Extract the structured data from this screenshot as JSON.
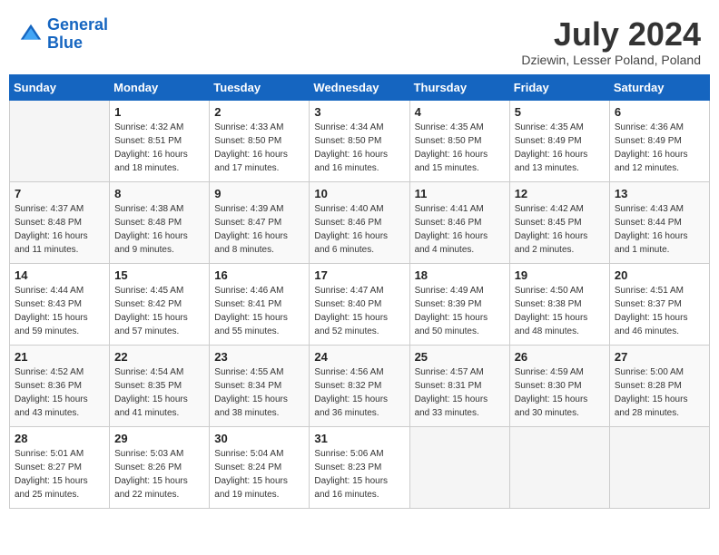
{
  "logo": {
    "line1": "General",
    "line2": "Blue"
  },
  "title": "July 2024",
  "location": "Dziewin, Lesser Poland, Poland",
  "weekdays": [
    "Sunday",
    "Monday",
    "Tuesday",
    "Wednesday",
    "Thursday",
    "Friday",
    "Saturday"
  ],
  "weeks": [
    [
      {
        "day": "",
        "sunrise": "",
        "sunset": "",
        "daylight": ""
      },
      {
        "day": "1",
        "sunrise": "Sunrise: 4:32 AM",
        "sunset": "Sunset: 8:51 PM",
        "daylight": "Daylight: 16 hours and 18 minutes."
      },
      {
        "day": "2",
        "sunrise": "Sunrise: 4:33 AM",
        "sunset": "Sunset: 8:50 PM",
        "daylight": "Daylight: 16 hours and 17 minutes."
      },
      {
        "day": "3",
        "sunrise": "Sunrise: 4:34 AM",
        "sunset": "Sunset: 8:50 PM",
        "daylight": "Daylight: 16 hours and 16 minutes."
      },
      {
        "day": "4",
        "sunrise": "Sunrise: 4:35 AM",
        "sunset": "Sunset: 8:50 PM",
        "daylight": "Daylight: 16 hours and 15 minutes."
      },
      {
        "day": "5",
        "sunrise": "Sunrise: 4:35 AM",
        "sunset": "Sunset: 8:49 PM",
        "daylight": "Daylight: 16 hours and 13 minutes."
      },
      {
        "day": "6",
        "sunrise": "Sunrise: 4:36 AM",
        "sunset": "Sunset: 8:49 PM",
        "daylight": "Daylight: 16 hours and 12 minutes."
      }
    ],
    [
      {
        "day": "7",
        "sunrise": "Sunrise: 4:37 AM",
        "sunset": "Sunset: 8:48 PM",
        "daylight": "Daylight: 16 hours and 11 minutes."
      },
      {
        "day": "8",
        "sunrise": "Sunrise: 4:38 AM",
        "sunset": "Sunset: 8:48 PM",
        "daylight": "Daylight: 16 hours and 9 minutes."
      },
      {
        "day": "9",
        "sunrise": "Sunrise: 4:39 AM",
        "sunset": "Sunset: 8:47 PM",
        "daylight": "Daylight: 16 hours and 8 minutes."
      },
      {
        "day": "10",
        "sunrise": "Sunrise: 4:40 AM",
        "sunset": "Sunset: 8:46 PM",
        "daylight": "Daylight: 16 hours and 6 minutes."
      },
      {
        "day": "11",
        "sunrise": "Sunrise: 4:41 AM",
        "sunset": "Sunset: 8:46 PM",
        "daylight": "Daylight: 16 hours and 4 minutes."
      },
      {
        "day": "12",
        "sunrise": "Sunrise: 4:42 AM",
        "sunset": "Sunset: 8:45 PM",
        "daylight": "Daylight: 16 hours and 2 minutes."
      },
      {
        "day": "13",
        "sunrise": "Sunrise: 4:43 AM",
        "sunset": "Sunset: 8:44 PM",
        "daylight": "Daylight: 16 hours and 1 minute."
      }
    ],
    [
      {
        "day": "14",
        "sunrise": "Sunrise: 4:44 AM",
        "sunset": "Sunset: 8:43 PM",
        "daylight": "Daylight: 15 hours and 59 minutes."
      },
      {
        "day": "15",
        "sunrise": "Sunrise: 4:45 AM",
        "sunset": "Sunset: 8:42 PM",
        "daylight": "Daylight: 15 hours and 57 minutes."
      },
      {
        "day": "16",
        "sunrise": "Sunrise: 4:46 AM",
        "sunset": "Sunset: 8:41 PM",
        "daylight": "Daylight: 15 hours and 55 minutes."
      },
      {
        "day": "17",
        "sunrise": "Sunrise: 4:47 AM",
        "sunset": "Sunset: 8:40 PM",
        "daylight": "Daylight: 15 hours and 52 minutes."
      },
      {
        "day": "18",
        "sunrise": "Sunrise: 4:49 AM",
        "sunset": "Sunset: 8:39 PM",
        "daylight": "Daylight: 15 hours and 50 minutes."
      },
      {
        "day": "19",
        "sunrise": "Sunrise: 4:50 AM",
        "sunset": "Sunset: 8:38 PM",
        "daylight": "Daylight: 15 hours and 48 minutes."
      },
      {
        "day": "20",
        "sunrise": "Sunrise: 4:51 AM",
        "sunset": "Sunset: 8:37 PM",
        "daylight": "Daylight: 15 hours and 46 minutes."
      }
    ],
    [
      {
        "day": "21",
        "sunrise": "Sunrise: 4:52 AM",
        "sunset": "Sunset: 8:36 PM",
        "daylight": "Daylight: 15 hours and 43 minutes."
      },
      {
        "day": "22",
        "sunrise": "Sunrise: 4:54 AM",
        "sunset": "Sunset: 8:35 PM",
        "daylight": "Daylight: 15 hours and 41 minutes."
      },
      {
        "day": "23",
        "sunrise": "Sunrise: 4:55 AM",
        "sunset": "Sunset: 8:34 PM",
        "daylight": "Daylight: 15 hours and 38 minutes."
      },
      {
        "day": "24",
        "sunrise": "Sunrise: 4:56 AM",
        "sunset": "Sunset: 8:32 PM",
        "daylight": "Daylight: 15 hours and 36 minutes."
      },
      {
        "day": "25",
        "sunrise": "Sunrise: 4:57 AM",
        "sunset": "Sunset: 8:31 PM",
        "daylight": "Daylight: 15 hours and 33 minutes."
      },
      {
        "day": "26",
        "sunrise": "Sunrise: 4:59 AM",
        "sunset": "Sunset: 8:30 PM",
        "daylight": "Daylight: 15 hours and 30 minutes."
      },
      {
        "day": "27",
        "sunrise": "Sunrise: 5:00 AM",
        "sunset": "Sunset: 8:28 PM",
        "daylight": "Daylight: 15 hours and 28 minutes."
      }
    ],
    [
      {
        "day": "28",
        "sunrise": "Sunrise: 5:01 AM",
        "sunset": "Sunset: 8:27 PM",
        "daylight": "Daylight: 15 hours and 25 minutes."
      },
      {
        "day": "29",
        "sunrise": "Sunrise: 5:03 AM",
        "sunset": "Sunset: 8:26 PM",
        "daylight": "Daylight: 15 hours and 22 minutes."
      },
      {
        "day": "30",
        "sunrise": "Sunrise: 5:04 AM",
        "sunset": "Sunset: 8:24 PM",
        "daylight": "Daylight: 15 hours and 19 minutes."
      },
      {
        "day": "31",
        "sunrise": "Sunrise: 5:06 AM",
        "sunset": "Sunset: 8:23 PM",
        "daylight": "Daylight: 15 hours and 16 minutes."
      },
      {
        "day": "",
        "sunrise": "",
        "sunset": "",
        "daylight": ""
      },
      {
        "day": "",
        "sunrise": "",
        "sunset": "",
        "daylight": ""
      },
      {
        "day": "",
        "sunrise": "",
        "sunset": "",
        "daylight": ""
      }
    ]
  ]
}
